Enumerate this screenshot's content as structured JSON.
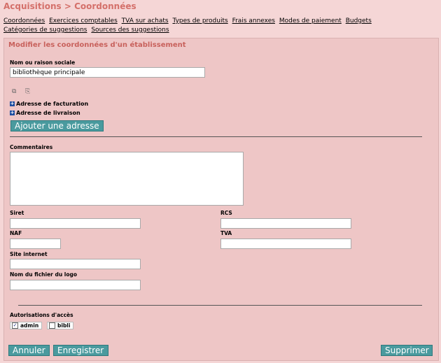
{
  "breadcrumb": "Acquisitions > Coordonnées",
  "tabs": [
    {
      "label": "Coordonnées"
    },
    {
      "label": "Exercices comptables"
    },
    {
      "label": "TVA sur achats"
    },
    {
      "label": "Types de produits"
    },
    {
      "label": "Frais annexes"
    },
    {
      "label": "Modes de paiement"
    },
    {
      "label": "Budgets"
    },
    {
      "label": "Catégories de suggestions"
    },
    {
      "label": "Sources des suggestions"
    }
  ],
  "form": {
    "title": "Modifier les coordonnées d'un établissement",
    "name_label": "Nom ou raison sociale",
    "name_value": "bibliothèque principale",
    "icons": [
      "copy-icon",
      "paste-icon"
    ],
    "billing_label": "Adresse de facturation",
    "delivery_label": "Adresse de livraison",
    "add_address_label": "Ajouter une adresse",
    "comments_label": "Commentaires",
    "comments_value": "",
    "siret_label": "Siret",
    "siret_value": "",
    "rcs_label": "RCS",
    "rcs_value": "",
    "naf_label": "NAF",
    "naf_value": "",
    "tva_label": "TVA",
    "tva_value": "",
    "website_label": "Site internet",
    "website_value": "",
    "logo_label": "Nom du fichier du logo",
    "logo_value": "",
    "access_label": "Autorisations d'accès",
    "access": [
      {
        "label": "admin",
        "checked": true
      },
      {
        "label": "bibli",
        "checked": false
      }
    ],
    "cancel_label": "Annuler",
    "save_label": "Enregistrer",
    "delete_label": "Supprimer"
  },
  "colors": {
    "background": "#f5d6d6",
    "panel": "#eec6c6",
    "title": "#d4706a",
    "button": "#4a9a9e"
  }
}
